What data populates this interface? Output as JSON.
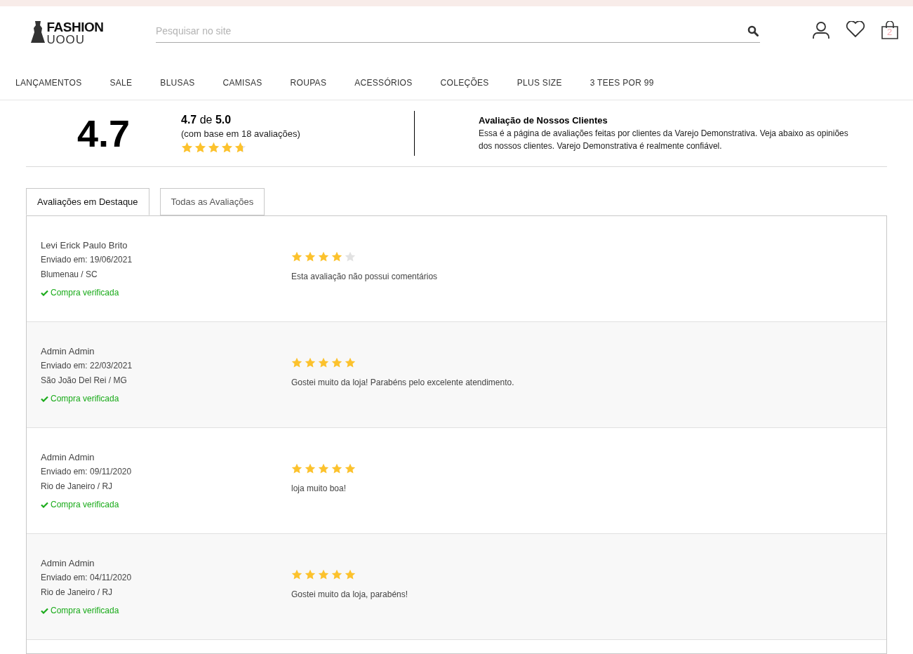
{
  "logo": {
    "line_1": "FASHION",
    "line_2": "UOOU"
  },
  "search": {
    "placeholder": "Pesquisar no site"
  },
  "cart": {
    "count": "2"
  },
  "nav": [
    "LANÇAMENTOS",
    "SALE",
    "BLUSAS",
    "CAMISAS",
    "ROUPAS",
    "ACESSÓRIOS",
    "COLEÇÕES",
    "PLUS SIZE",
    "3 TEES POR 99"
  ],
  "summary": {
    "score": "4.7",
    "score_line": "**4.7** de **5.0**",
    "count_line": "(com base em 18 avaliações)",
    "stars": 4.7,
    "title": "Avaliação de Nossos Clientes",
    "text": "Essa é a página de avaliações feitas por clientes da Varejo Demonstrativa. Veja abaixo as opiniões dos nossos clientes. Varejo Demonstrativa é realmente confiável."
  },
  "tabs": [
    {
      "label": "Avaliações em Destaque",
      "selected": true
    },
    {
      "label": "Todas as Avaliações",
      "selected": false
    }
  ],
  "reviews": [
    {
      "name": "Levi Erick Paulo Brito",
      "date": "Enviado em: 19/06/2021",
      "place": "Blumenau / SC",
      "verified": "Compra verificada",
      "stars": 4,
      "comment": "Esta avaliação não possui comentários"
    },
    {
      "name": "Admin Admin",
      "date": "Enviado em: 22/03/2021",
      "place": "São João Del Rei / MG",
      "verified": "Compra verificada",
      "stars": 5,
      "comment": "Gostei muito da loja! Parabéns pelo excelente atendimento."
    },
    {
      "name": "Admin Admin",
      "date": "Enviado em: 09/11/2020",
      "place": "Rio de Janeiro / RJ",
      "verified": "Compra verificada",
      "stars": 5,
      "comment": "loja muito boa!"
    },
    {
      "name": "Admin Admin",
      "date": "Enviado em: 04/11/2020",
      "place": "Rio de Janeiro / RJ",
      "verified": "Compra verificada",
      "stars": 5,
      "comment": "Gostei muito da loja, parabéns!"
    }
  ]
}
